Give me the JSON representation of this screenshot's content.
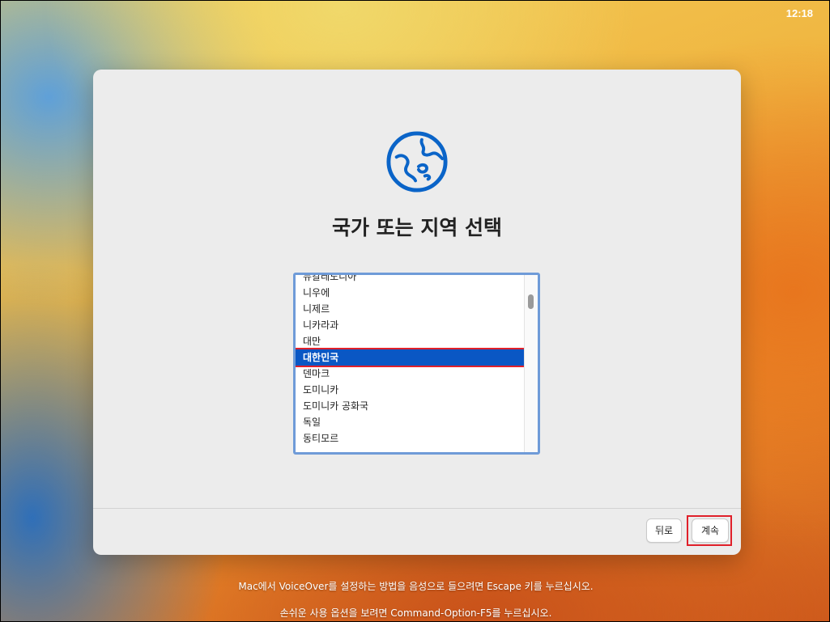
{
  "status_bar": {
    "clock": "12:18"
  },
  "dialog": {
    "title": "국가 또는 지역 선택",
    "list_items": [
      "뉴칼레도니아",
      "니우에",
      "니제르",
      "니카라과",
      "대만",
      "대한민국",
      "덴마크",
      "도미니카",
      "도미니카 공화국",
      "독일",
      "동티모르"
    ],
    "selected_item": "대한민국",
    "buttons": {
      "back": "뒤로",
      "continue": "계속"
    }
  },
  "footer": {
    "line1": "Mac에서 VoiceOver를 설정하는 방법을 음성으로 들으려면 Escape 키를 누르십시오.",
    "line2": "손쉬운 사용 옵션을 보려면 Command-Option-F5를 누르십시오."
  },
  "colors": {
    "accent": "#0a57c4",
    "globe": "#0a64c8",
    "highlight_box": "#e0202a"
  },
  "icons": {
    "globe": "globe-icon"
  }
}
